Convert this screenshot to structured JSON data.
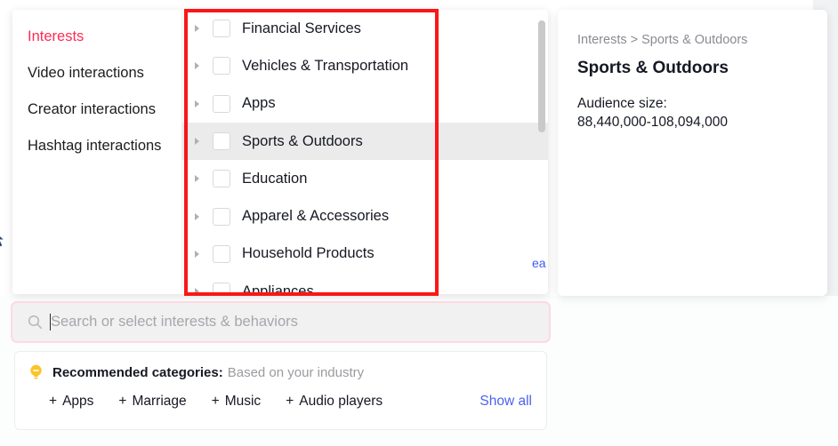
{
  "colors": {
    "accent_pink": "#fe2c55",
    "annotation_red": "#f91717",
    "link_blue": "#4a62f0",
    "selected_row_bg": "#ebebeb",
    "muted_text": "#9a9b9f"
  },
  "sidebar": {
    "items": [
      {
        "label": "Interests",
        "active": true
      },
      {
        "label": "Video interactions",
        "active": false
      },
      {
        "label": "Creator interactions",
        "active": false
      },
      {
        "label": "Hashtag interactions",
        "active": false
      }
    ]
  },
  "category_list": {
    "rows": [
      {
        "label": "Financial Services",
        "selected": false,
        "checked": false
      },
      {
        "label": "Vehicles & Transportation",
        "selected": false,
        "checked": false
      },
      {
        "label": "Apps",
        "selected": false,
        "checked": false
      },
      {
        "label": "Sports & Outdoors",
        "selected": true,
        "checked": false
      },
      {
        "label": "Education",
        "selected": false,
        "checked": false
      },
      {
        "label": "Apparel & Accessories",
        "selected": false,
        "checked": false
      },
      {
        "label": "Household Products",
        "selected": false,
        "checked": false
      },
      {
        "label": "Appliances",
        "selected": false,
        "checked": false
      }
    ],
    "clipped_link_text": "ea"
  },
  "detail": {
    "breadcrumb": "Interests > Sports & Outdoors",
    "title": "Sports & Outdoors",
    "audience_label": "Audience size:",
    "audience_value": "88,440,000-108,094,000"
  },
  "search": {
    "placeholder": "Search or select interests & behaviors",
    "value": ""
  },
  "recommended": {
    "title": "Recommended categories:",
    "subtitle": "Based on your industry",
    "chips": [
      {
        "plus": "+",
        "label": "Apps"
      },
      {
        "plus": "+",
        "label": "Marriage"
      },
      {
        "plus": "+",
        "label": "Music"
      },
      {
        "plus": "+",
        "label": "Audio players"
      }
    ],
    "show_all": "Show all"
  }
}
